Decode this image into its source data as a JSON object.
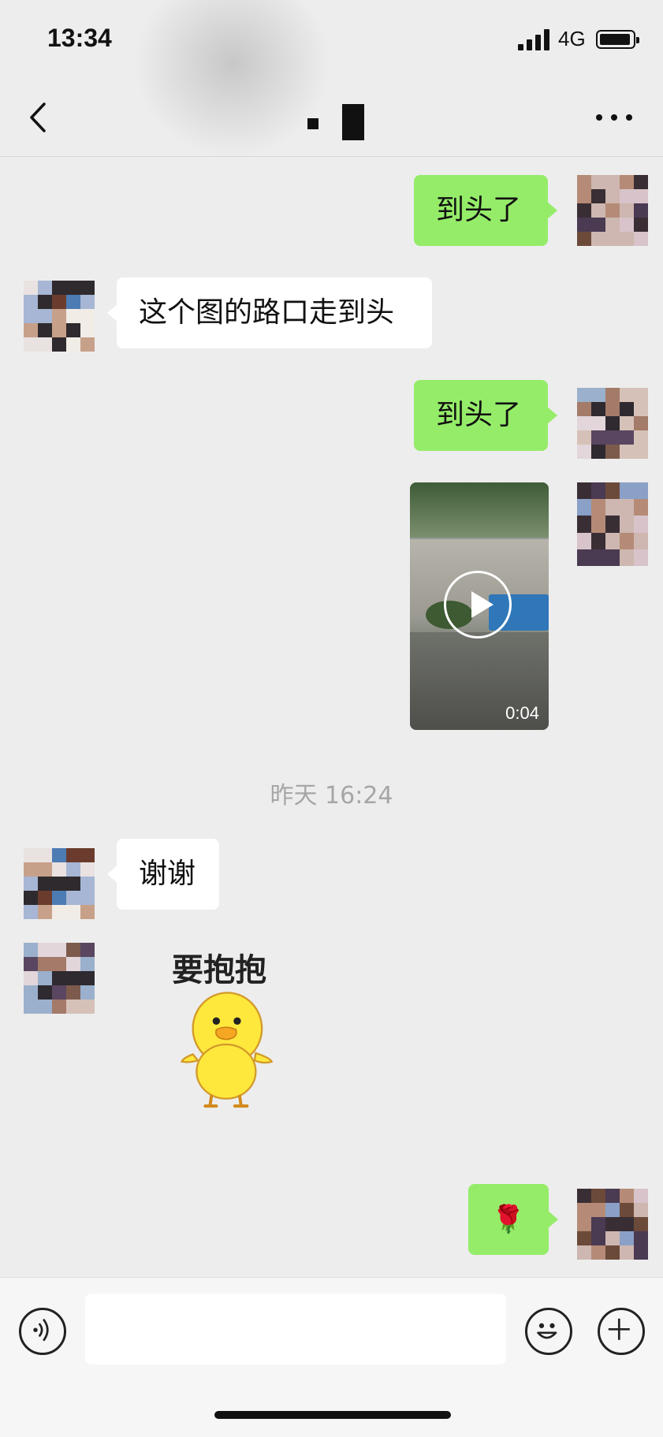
{
  "status_bar": {
    "time": "13:34",
    "network": "4G"
  },
  "nav": {
    "back_icon": "chevron-left-icon",
    "more_icon": "more-dots-icon"
  },
  "messages": [
    {
      "side": "me",
      "type": "text",
      "text": "到头了"
    },
    {
      "side": "other",
      "type": "text",
      "text": "这个图的路口走到头"
    },
    {
      "side": "me",
      "type": "text",
      "text": "到头了"
    },
    {
      "side": "me",
      "type": "video",
      "duration": "0:04"
    },
    {
      "side": "system",
      "type": "timestamp",
      "text": "昨天 16:24"
    },
    {
      "side": "other",
      "type": "text",
      "text": "谢谢"
    },
    {
      "side": "other",
      "type": "sticker",
      "text": "要抱抱"
    },
    {
      "side": "me",
      "type": "emoji",
      "text": "🌹"
    }
  ],
  "input_bar": {
    "voice_icon": "voice-icon",
    "emoji_icon": "emoji-icon",
    "plus_icon": "plus-icon",
    "value": ""
  },
  "colors": {
    "me_bubble": "#95ec69",
    "other_bubble": "#ffffff",
    "background": "#ededed"
  }
}
